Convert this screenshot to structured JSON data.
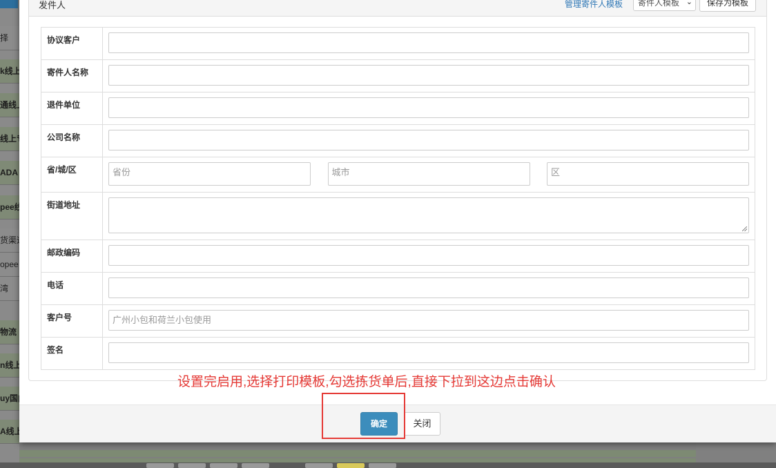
{
  "background": {
    "list_items": [
      {
        "text": "择",
        "style": "plain"
      },
      {
        "text": "k线上",
        "style": "green"
      },
      {
        "text": "通线上",
        "style": "green"
      },
      {
        "text": "线上专",
        "style": "green"
      },
      {
        "text": "ADA",
        "style": "green"
      },
      {
        "text": "pee线",
        "style": "green"
      },
      {
        "text": "货渠道",
        "style": "plain"
      },
      {
        "text": "opee",
        "style": "plain"
      },
      {
        "text": "湾",
        "style": "plain"
      },
      {
        "text": "物流",
        "style": "green"
      },
      {
        "text": "n线上",
        "style": "green"
      },
      {
        "text": "uy国内",
        "style": "green"
      },
      {
        "text": "A线上",
        "style": "green"
      }
    ]
  },
  "panel": {
    "title": "发件人",
    "manage_link": "管理寄件人模板",
    "template_select": "寄件人模板",
    "save_template_button": "保存为模板"
  },
  "form": {
    "agreement_customer": {
      "label": "协议客户",
      "value": ""
    },
    "sender_name": {
      "label": "寄件人名称",
      "value": ""
    },
    "return_unit": {
      "label": "退件单位",
      "value": ""
    },
    "company_name": {
      "label": "公司名称",
      "value": ""
    },
    "region": {
      "label": "省/城/区",
      "province_placeholder": "省份",
      "city_placeholder": "城市",
      "district_placeholder": "区"
    },
    "street": {
      "label": "街道地址",
      "value": ""
    },
    "postcode": {
      "label": "邮政编码",
      "value": ""
    },
    "phone": {
      "label": "电话",
      "value": ""
    },
    "customer_no": {
      "label": "客户号",
      "placeholder": "广州小包和荷兰小包使用"
    },
    "signature": {
      "label": "签名",
      "value": ""
    }
  },
  "annotation": "设置完启用,选择打印模板,勾选拣货单后,直接下拉到这边点击确认",
  "footer": {
    "confirm_button": "确定",
    "close_button": "关闭"
  },
  "colors": {
    "primary": "#3c8dbc",
    "link": "#337ab7",
    "annotation": "#e53935"
  }
}
